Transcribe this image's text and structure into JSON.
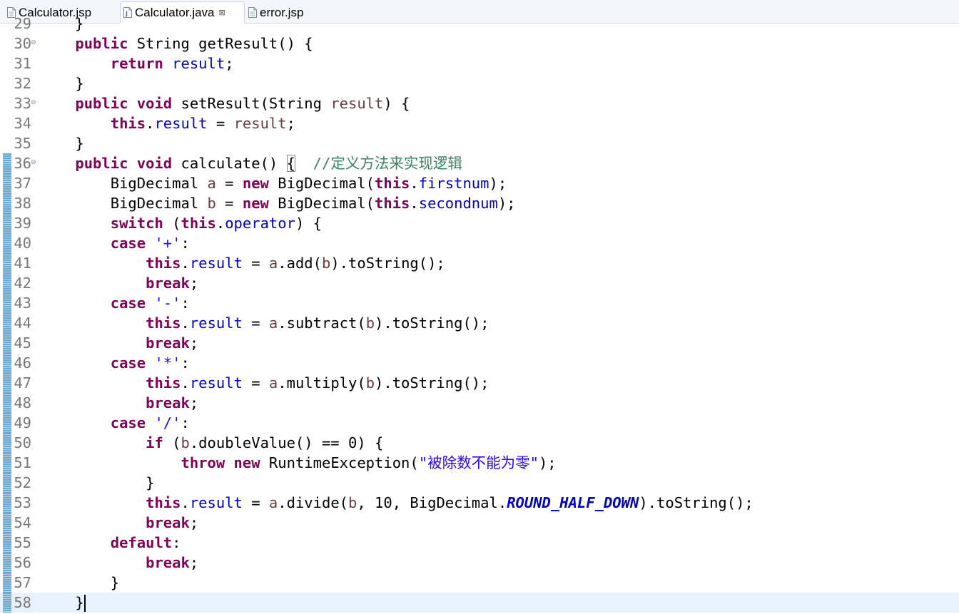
{
  "tabs": [
    {
      "label": "Calculator.jsp",
      "icon": "jsp-file-icon",
      "active": false
    },
    {
      "label": "Calculator.java",
      "icon": "java-file-icon",
      "active": true,
      "close": "⊠"
    },
    {
      "label": "error.jsp",
      "icon": "jsp-file-icon",
      "active": false
    }
  ],
  "editor": {
    "partial_top": {
      "number": "29",
      "text": "}"
    },
    "lines": [
      {
        "number": "30",
        "fold": "⊖",
        "tokens": [
          [
            "    ",
            ""
          ],
          [
            "public",
            "kw"
          ],
          [
            " String getResult() {",
            ""
          ]
        ]
      },
      {
        "number": "31",
        "tokens": [
          [
            "        ",
            ""
          ],
          [
            "return",
            "kw"
          ],
          [
            " ",
            ""
          ],
          [
            "result",
            "fld"
          ],
          [
            ";",
            ""
          ]
        ]
      },
      {
        "number": "32",
        "tokens": [
          [
            "    }",
            ""
          ]
        ]
      },
      {
        "number": "33",
        "fold": "⊖",
        "tokens": [
          [
            "    ",
            ""
          ],
          [
            "public",
            "kw"
          ],
          [
            " ",
            ""
          ],
          [
            "void",
            "kw"
          ],
          [
            " setResult(String ",
            ""
          ],
          [
            "result",
            "var"
          ],
          [
            ") {",
            ""
          ]
        ]
      },
      {
        "number": "34",
        "tokens": [
          [
            "        ",
            ""
          ],
          [
            "this",
            "kw"
          ],
          [
            ".",
            ""
          ],
          [
            "result",
            "fld"
          ],
          [
            " = ",
            ""
          ],
          [
            "result",
            "var"
          ],
          [
            ";",
            ""
          ]
        ]
      },
      {
        "number": "35",
        "tokens": [
          [
            "    }",
            ""
          ]
        ]
      },
      {
        "number": "36",
        "fold": "⊖",
        "changed": true,
        "tokens": [
          [
            "    ",
            ""
          ],
          [
            "public",
            "kw"
          ],
          [
            " ",
            ""
          ],
          [
            "void",
            "kw"
          ],
          [
            " calculate() ",
            ""
          ],
          [
            "{",
            "brace-box"
          ],
          [
            "  ",
            ""
          ],
          [
            "//定义方法来实现逻辑",
            "cmt"
          ]
        ]
      },
      {
        "number": "37",
        "changed": true,
        "tokens": [
          [
            "        BigDecimal ",
            ""
          ],
          [
            "a",
            "var"
          ],
          [
            " = ",
            ""
          ],
          [
            "new",
            "kw"
          ],
          [
            " BigDecimal(",
            ""
          ],
          [
            "this",
            "kw"
          ],
          [
            ".",
            ""
          ],
          [
            "firstnum",
            "fld"
          ],
          [
            ");",
            ""
          ]
        ]
      },
      {
        "number": "38",
        "changed": true,
        "tokens": [
          [
            "        BigDecimal ",
            ""
          ],
          [
            "b",
            "var"
          ],
          [
            " = ",
            ""
          ],
          [
            "new",
            "kw"
          ],
          [
            " BigDecimal(",
            ""
          ],
          [
            "this",
            "kw"
          ],
          [
            ".",
            ""
          ],
          [
            "secondnum",
            "fld"
          ],
          [
            ");",
            ""
          ]
        ]
      },
      {
        "number": "39",
        "changed": true,
        "tokens": [
          [
            "        ",
            ""
          ],
          [
            "switch",
            "kw"
          ],
          [
            " (",
            ""
          ],
          [
            "this",
            "kw"
          ],
          [
            ".",
            ""
          ],
          [
            "operator",
            "fld"
          ],
          [
            ") {",
            ""
          ]
        ]
      },
      {
        "number": "40",
        "changed": true,
        "tokens": [
          [
            "        ",
            ""
          ],
          [
            "case",
            "kw"
          ],
          [
            " ",
            ""
          ],
          [
            "'+'",
            "str"
          ],
          [
            ":",
            ""
          ]
        ]
      },
      {
        "number": "41",
        "changed": true,
        "tokens": [
          [
            "            ",
            ""
          ],
          [
            "this",
            "kw"
          ],
          [
            ".",
            ""
          ],
          [
            "result",
            "fld"
          ],
          [
            " = ",
            ""
          ],
          [
            "a",
            "var"
          ],
          [
            ".add(",
            ""
          ],
          [
            "b",
            "var"
          ],
          [
            ").toString();",
            ""
          ]
        ]
      },
      {
        "number": "42",
        "changed": true,
        "tokens": [
          [
            "            ",
            ""
          ],
          [
            "break",
            "kw"
          ],
          [
            ";",
            ""
          ]
        ]
      },
      {
        "number": "43",
        "changed": true,
        "tokens": [
          [
            "        ",
            ""
          ],
          [
            "case",
            "kw"
          ],
          [
            " ",
            ""
          ],
          [
            "'-'",
            "str"
          ],
          [
            ":",
            ""
          ]
        ]
      },
      {
        "number": "44",
        "changed": true,
        "tokens": [
          [
            "            ",
            ""
          ],
          [
            "this",
            "kw"
          ],
          [
            ".",
            ""
          ],
          [
            "result",
            "fld"
          ],
          [
            " = ",
            ""
          ],
          [
            "a",
            "var"
          ],
          [
            ".subtract(",
            ""
          ],
          [
            "b",
            "var"
          ],
          [
            ").toString();",
            ""
          ]
        ]
      },
      {
        "number": "45",
        "changed": true,
        "tokens": [
          [
            "            ",
            ""
          ],
          [
            "break",
            "kw"
          ],
          [
            ";",
            ""
          ]
        ]
      },
      {
        "number": "46",
        "changed": true,
        "tokens": [
          [
            "        ",
            ""
          ],
          [
            "case",
            "kw"
          ],
          [
            " ",
            ""
          ],
          [
            "'*'",
            "str"
          ],
          [
            ":",
            ""
          ]
        ]
      },
      {
        "number": "47",
        "changed": true,
        "tokens": [
          [
            "            ",
            ""
          ],
          [
            "this",
            "kw"
          ],
          [
            ".",
            ""
          ],
          [
            "result",
            "fld"
          ],
          [
            " = ",
            ""
          ],
          [
            "a",
            "var"
          ],
          [
            ".multiply(",
            ""
          ],
          [
            "b",
            "var"
          ],
          [
            ").toString();",
            ""
          ]
        ]
      },
      {
        "number": "48",
        "changed": true,
        "tokens": [
          [
            "            ",
            ""
          ],
          [
            "break",
            "kw"
          ],
          [
            ";",
            ""
          ]
        ]
      },
      {
        "number": "49",
        "changed": true,
        "tokens": [
          [
            "        ",
            ""
          ],
          [
            "case",
            "kw"
          ],
          [
            " ",
            ""
          ],
          [
            "'/'",
            "str"
          ],
          [
            ":",
            ""
          ]
        ]
      },
      {
        "number": "50",
        "changed": true,
        "tokens": [
          [
            "            ",
            ""
          ],
          [
            "if",
            "kw"
          ],
          [
            " (",
            ""
          ],
          [
            "b",
            "var"
          ],
          [
            ".doubleValue() == 0) {",
            ""
          ]
        ]
      },
      {
        "number": "51",
        "changed": true,
        "tokens": [
          [
            "                ",
            ""
          ],
          [
            "throw",
            "kw"
          ],
          [
            " ",
            ""
          ],
          [
            "new",
            "kw"
          ],
          [
            " RuntimeException(",
            ""
          ],
          [
            "\"被除数不能为零\"",
            "str"
          ],
          [
            ");",
            ""
          ]
        ]
      },
      {
        "number": "52",
        "changed": true,
        "tokens": [
          [
            "            }",
            ""
          ]
        ]
      },
      {
        "number": "53",
        "changed": true,
        "tokens": [
          [
            "            ",
            ""
          ],
          [
            "this",
            "kw"
          ],
          [
            ".",
            ""
          ],
          [
            "result",
            "fld"
          ],
          [
            " = ",
            ""
          ],
          [
            "a",
            "var"
          ],
          [
            ".divide(",
            ""
          ],
          [
            "b",
            "var"
          ],
          [
            ", 10, BigDecimal.",
            ""
          ],
          [
            "ROUND_HALF_DOWN",
            "const"
          ],
          [
            ").toString();",
            ""
          ]
        ]
      },
      {
        "number": "54",
        "changed": true,
        "tokens": [
          [
            "            ",
            ""
          ],
          [
            "break",
            "kw"
          ],
          [
            ";",
            ""
          ]
        ]
      },
      {
        "number": "55",
        "changed": true,
        "tokens": [
          [
            "        ",
            ""
          ],
          [
            "default",
            "kw"
          ],
          [
            ":",
            ""
          ]
        ]
      },
      {
        "number": "56",
        "changed": true,
        "tokens": [
          [
            "            ",
            ""
          ],
          [
            "break",
            "kw"
          ],
          [
            ";",
            ""
          ]
        ]
      },
      {
        "number": "57",
        "changed": true,
        "tokens": [
          [
            "        }",
            ""
          ]
        ]
      },
      {
        "number": "58",
        "changed": true,
        "current": true,
        "caret": true,
        "tokens": [
          [
            "    }",
            ""
          ]
        ]
      }
    ]
  }
}
